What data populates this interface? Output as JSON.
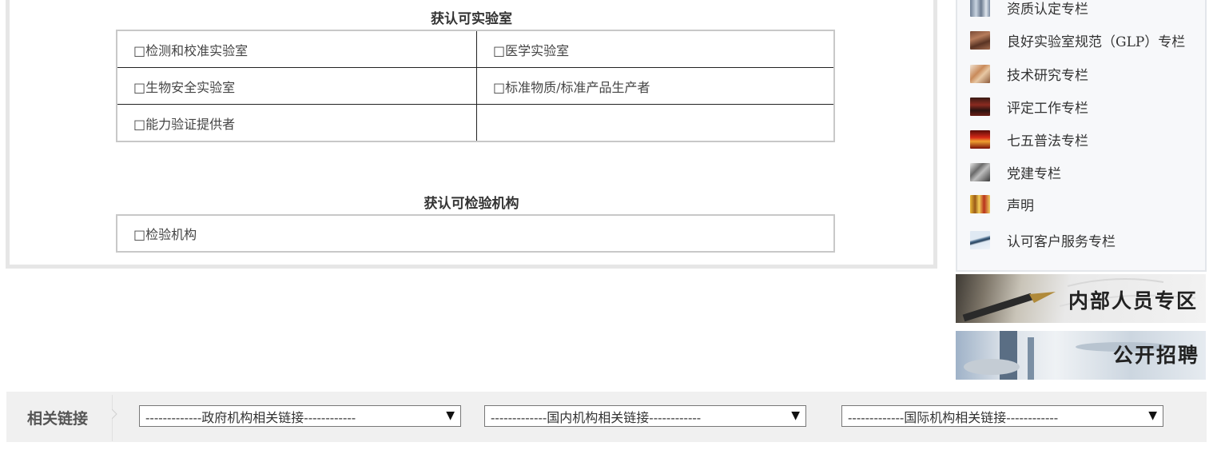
{
  "lab_section": {
    "title": "获认可实验室",
    "rows": [
      [
        "□检测和校准实验室",
        "□医学实验室"
      ],
      [
        "□生物安全实验室",
        "□标准物质/标准产品生产者"
      ],
      [
        "□能力验证提供者",
        ""
      ]
    ]
  },
  "inspection_section": {
    "title": "获认可检验机构",
    "rows": [
      [
        "□检验机构"
      ]
    ]
  },
  "sidebar": {
    "items": [
      {
        "label": "资质认定专栏",
        "icon": "building-photo-icon"
      },
      {
        "label": "良好实验室规范（GLP）专栏",
        "icon": "documents-photo-icon"
      },
      {
        "label": "技术研究专栏",
        "icon": "handshake-photo-icon"
      },
      {
        "label": "评定工作专栏",
        "icon": "gavel-photo-icon"
      },
      {
        "label": "七五普法专栏",
        "icon": "lanterns-photo-icon"
      },
      {
        "label": "党建专栏",
        "icon": "party-photo-icon"
      },
      {
        "label": "声明",
        "icon": "books-photo-icon"
      },
      {
        "label": "认可客户服务专栏",
        "icon": "pen-photo-icon"
      }
    ]
  },
  "banners": {
    "internal": "内部人员专区",
    "recruit": "公开招聘"
  },
  "links": {
    "title": "相关链接",
    "selects": [
      "-------------政府机构相关链接------------",
      "-------------国内机构相关链接------------",
      "-------------国际机构相关链接------------"
    ]
  }
}
